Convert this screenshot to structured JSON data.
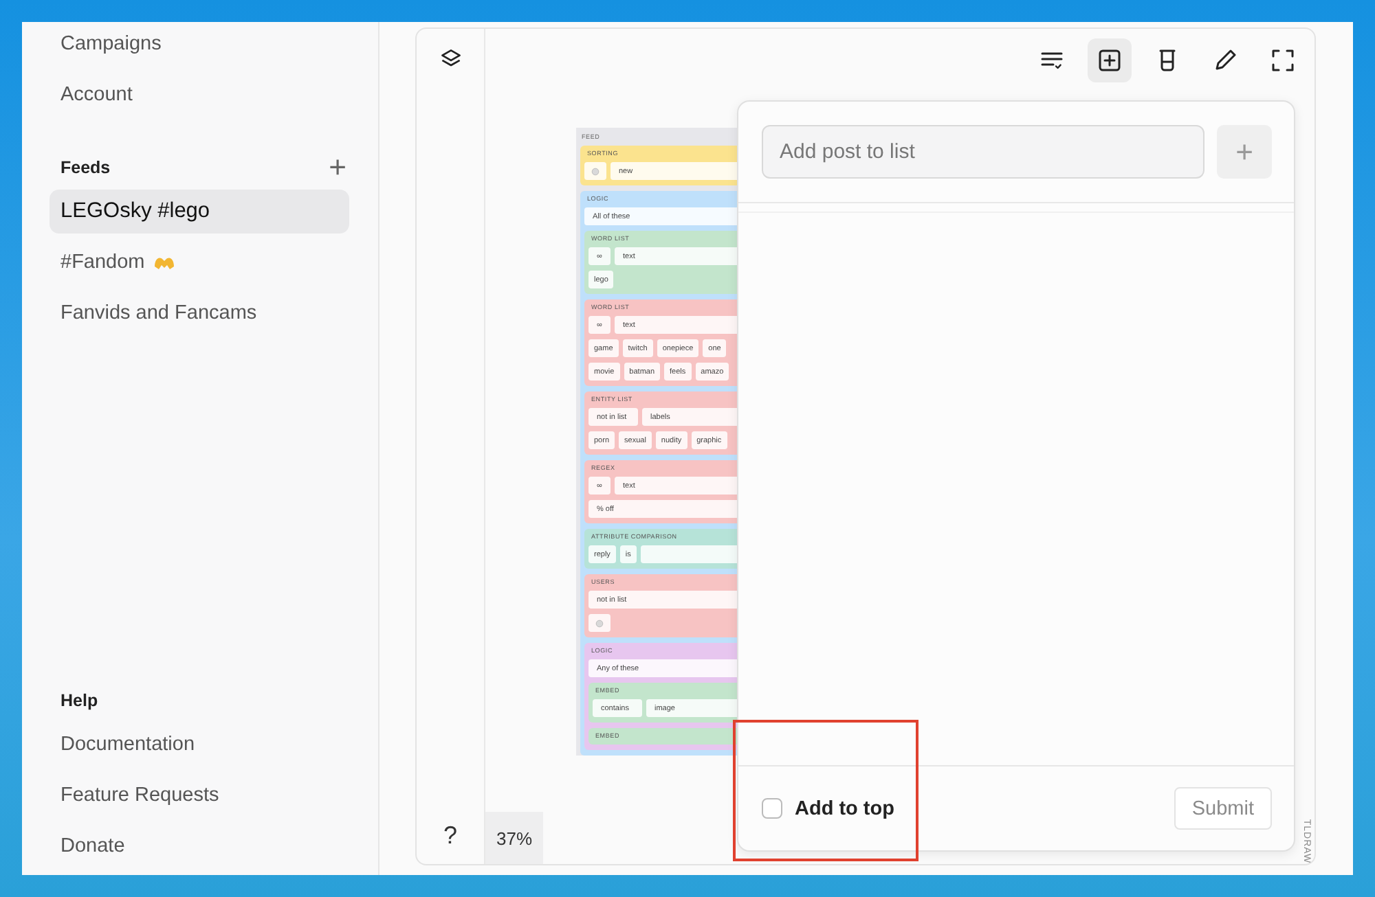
{
  "sidebar": {
    "top_items": [
      {
        "label": "Campaigns",
        "selected": false
      },
      {
        "label": "Account",
        "selected": false
      }
    ],
    "sections": [
      {
        "title": "Feeds",
        "add_button": "+",
        "items": [
          {
            "label": "LEGOsky #lego",
            "selected": true,
            "has_icon": false
          },
          {
            "label": "#Fandom",
            "selected": false,
            "has_icon": true
          },
          {
            "label": "Fanvids and Fancams",
            "selected": false,
            "has_icon": false
          }
        ]
      },
      {
        "title": "Help",
        "items": [
          {
            "label": "Documentation",
            "selected": false,
            "has_icon": false
          },
          {
            "label": "Feature Requests",
            "selected": false,
            "has_icon": false
          },
          {
            "label": "Donate",
            "selected": false,
            "has_icon": false
          }
        ]
      }
    ]
  },
  "toolbar": [
    {
      "kind": "list",
      "selected": false
    },
    {
      "kind": "add",
      "selected": true
    },
    {
      "kind": "glass",
      "selected": false
    },
    {
      "kind": "pen",
      "selected": false
    },
    {
      "kind": "fullscreen",
      "selected": false
    }
  ],
  "help_button": "?",
  "zoom": "37%",
  "watermark_label": "TLDRAW",
  "diagram": {
    "title": "FEED",
    "blocks": [
      {
        "title": "SORTING",
        "color": "#fbe38e",
        "rows": [
          {
            "cells": [
              {
                "kind": "icon"
              },
              {
                "kind": "field",
                "text": "new"
              }
            ]
          }
        ]
      },
      {
        "title": "LOGIC",
        "color": "#bfe0fb",
        "rows": [
          {
            "cells": [
              {
                "kind": "field",
                "text": "All of these"
              }
            ]
          }
        ],
        "blocks": [
          {
            "title": "WORD LIST",
            "color": "#c3e5cc",
            "rows": [
              {
                "cells": [
                  {
                    "kind": "op",
                    "text": "∞"
                  },
                  {
                    "kind": "field",
                    "text": "text"
                  }
                ]
              },
              {
                "cells": [
                  {
                    "kind": "chip",
                    "text": "lego"
                  }
                ]
              }
            ]
          },
          {
            "title": "WORD LIST",
            "color": "#f7c3c3",
            "rows": [
              {
                "cells": [
                  {
                    "kind": "op",
                    "text": "∞"
                  },
                  {
                    "kind": "field",
                    "text": "text"
                  }
                ]
              },
              {
                "cells": [
                  {
                    "kind": "chip",
                    "text": "game"
                  },
                  {
                    "kind": "chip",
                    "text": "twitch"
                  },
                  {
                    "kind": "chip",
                    "text": "onepiece"
                  },
                  {
                    "kind": "chip",
                    "text": "one"
                  }
                ]
              },
              {
                "cells": [
                  {
                    "kind": "chip",
                    "text": "movie"
                  },
                  {
                    "kind": "chip",
                    "text": "batman"
                  },
                  {
                    "kind": "chip",
                    "text": "feels"
                  },
                  {
                    "kind": "chip",
                    "text": "amazo"
                  }
                ]
              }
            ]
          },
          {
            "title": "ENTITY LIST",
            "color": "#f7c3c3",
            "rows": [
              {
                "cells": [
                  {
                    "kind": "field",
                    "text": "not in list"
                  },
                  {
                    "kind": "field",
                    "text": "labels"
                  }
                ]
              },
              {
                "cells": [
                  {
                    "kind": "chip",
                    "text": "porn"
                  },
                  {
                    "kind": "chip",
                    "text": "sexual"
                  },
                  {
                    "kind": "chip",
                    "text": "nudity"
                  },
                  {
                    "kind": "chip",
                    "text": "graphic"
                  }
                ]
              }
            ]
          },
          {
            "title": "REGEX",
            "color": "#f7c3c3",
            "rows": [
              {
                "cells": [
                  {
                    "kind": "op",
                    "text": "∞"
                  },
                  {
                    "kind": "field",
                    "text": "text"
                  }
                ]
              },
              {
                "cells": [
                  {
                    "kind": "field",
                    "text": "% off"
                  }
                ]
              }
            ]
          },
          {
            "title": "ATTRIBUTE COMPARISON",
            "color": "#b6e3d8",
            "rows": [
              {
                "cells": [
                  {
                    "kind": "chip",
                    "text": "reply"
                  },
                  {
                    "kind": "chip",
                    "text": "is"
                  },
                  {
                    "kind": "field"
                  }
                ]
              }
            ]
          },
          {
            "title": "USERS",
            "color": "#f7c3c3",
            "rows": [
              {
                "cells": [
                  {
                    "kind": "field",
                    "text": "not in list"
                  }
                ]
              },
              {
                "cells": [
                  {
                    "kind": "icon"
                  }
                ]
              }
            ]
          },
          {
            "title": "LOGIC",
            "color": "#e7c6ef",
            "rows": [
              {
                "cells": [
                  {
                    "kind": "field",
                    "text": "Any of these"
                  }
                ]
              }
            ],
            "blocks": [
              {
                "title": "EMBED",
                "color": "#c3e5cc",
                "rows": [
                  {
                    "cells": [
                      {
                        "kind": "field",
                        "text": "contains"
                      },
                      {
                        "kind": "field",
                        "text": "image"
                      }
                    ]
                  }
                ]
              },
              {
                "title": "EMBED",
                "color": "#c3e5cc"
              }
            ]
          }
        ]
      }
    ]
  },
  "panel": {
    "input": {
      "placeholder": "Add post to list"
    },
    "add_button": "+",
    "checkbox": {
      "label": "Add to top",
      "checked": false
    },
    "submit": {
      "label": "Submit",
      "disabled": true
    }
  }
}
